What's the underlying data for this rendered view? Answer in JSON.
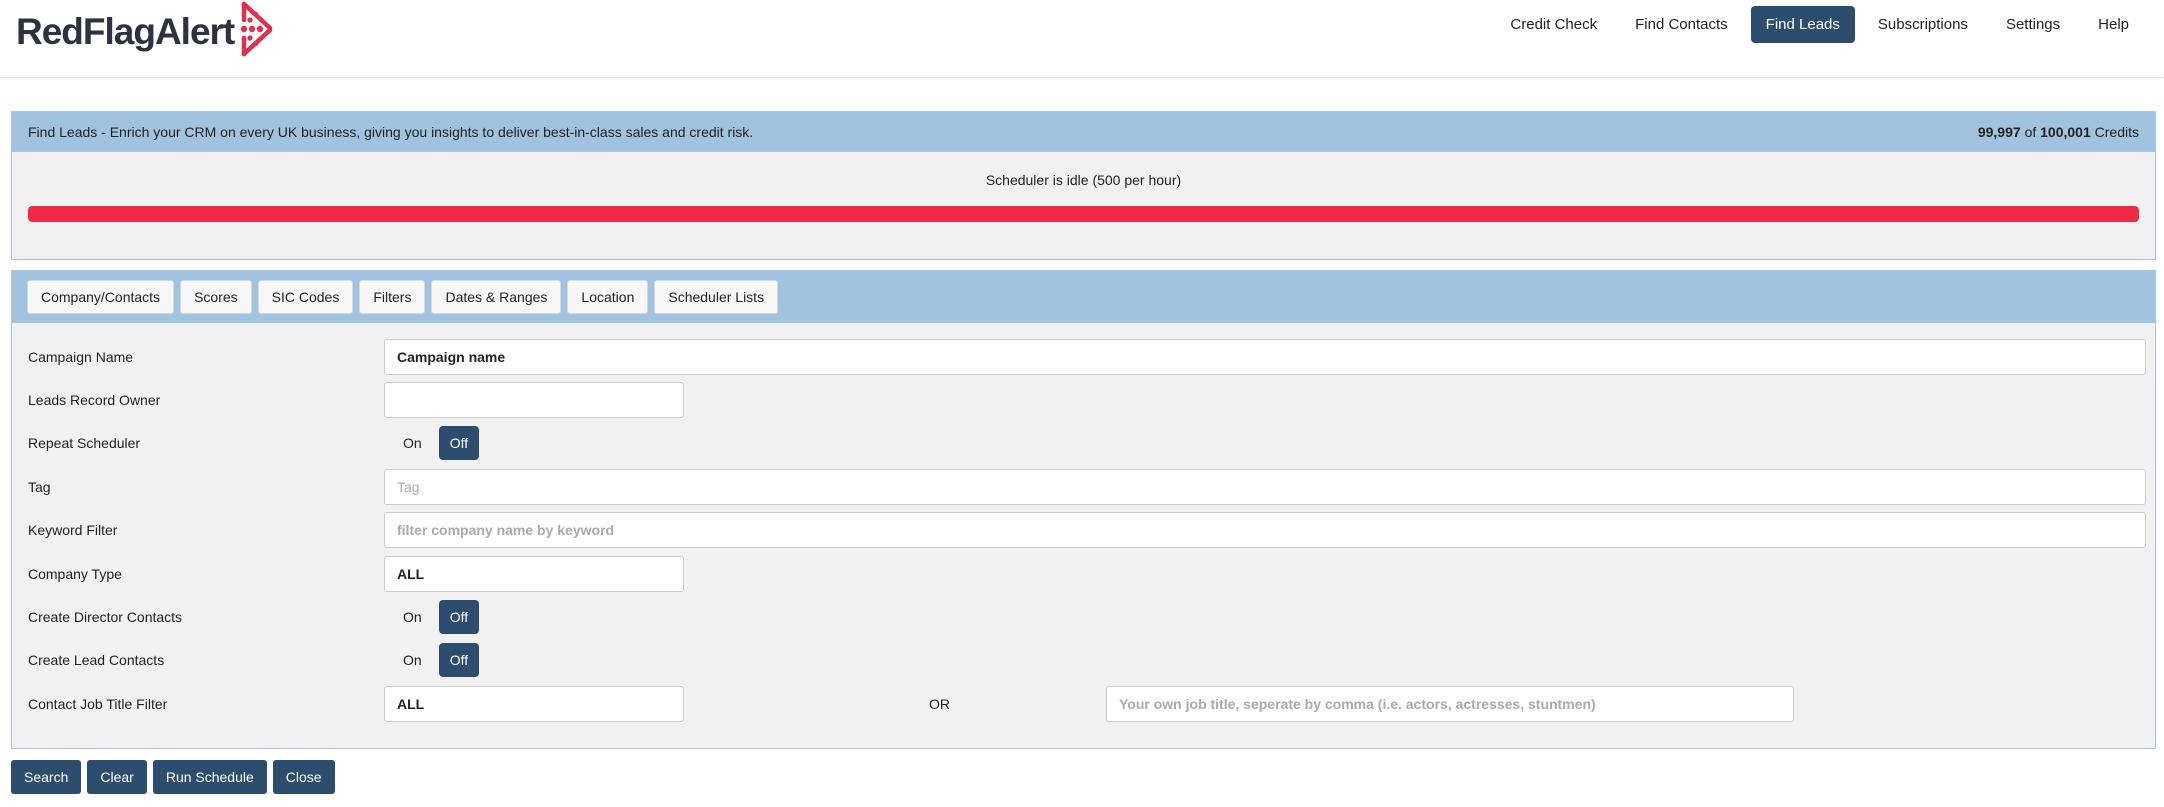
{
  "brand": {
    "name": "RedFlagAlert",
    "color": "#e0304f",
    "text_color": "#2e3240"
  },
  "nav": {
    "items": [
      {
        "label": "Credit Check",
        "active": false
      },
      {
        "label": "Find Contacts",
        "active": false
      },
      {
        "label": "Find Leads",
        "active": true
      },
      {
        "label": "Subscriptions",
        "active": false
      },
      {
        "label": "Settings",
        "active": false
      },
      {
        "label": "Help",
        "active": false
      }
    ]
  },
  "info_panel": {
    "description": "Find Leads - Enrich your CRM on every UK business, giving you insights to deliver best-in-class sales and credit risk.",
    "credits_used": "99,997",
    "credits_of": "of",
    "credits_total": "100,001",
    "credits_label": "Credits",
    "scheduler_status": "Scheduler is idle (500 per hour)",
    "progress_fraction": 1.0,
    "progress_color": "#ef2a45"
  },
  "tabs": [
    {
      "label": "Company/Contacts"
    },
    {
      "label": "Scores"
    },
    {
      "label": "SIC Codes"
    },
    {
      "label": "Filters"
    },
    {
      "label": "Dates & Ranges"
    },
    {
      "label": "Location"
    },
    {
      "label": "Scheduler Lists"
    }
  ],
  "form": {
    "campaign_name": {
      "label": "Campaign Name",
      "value": "Campaign name"
    },
    "leads_record_owner": {
      "label": "Leads Record Owner",
      "value": ""
    },
    "repeat_scheduler": {
      "label": "Repeat Scheduler",
      "on": "On",
      "off": "Off",
      "selected": "Off"
    },
    "tag": {
      "label": "Tag",
      "placeholder": "Tag"
    },
    "keyword_filter": {
      "label": "Keyword Filter",
      "placeholder": "filter company name by keyword"
    },
    "company_type": {
      "label": "Company Type",
      "value": "ALL"
    },
    "create_director_contacts": {
      "label": "Create Director Contacts",
      "on": "On",
      "off": "Off",
      "selected": "Off"
    },
    "create_lead_contacts": {
      "label": "Create Lead Contacts",
      "on": "On",
      "off": "Off",
      "selected": "Off"
    },
    "contact_job_title_filter": {
      "label": "Contact Job Title Filter",
      "value": "ALL",
      "or_text": "OR",
      "placeholder": "Your own job title, seperate by comma (i.e. actors, actresses, stuntmen)"
    }
  },
  "actions": {
    "search": "Search",
    "clear": "Clear",
    "run_schedule": "Run Schedule",
    "close": "Close"
  },
  "colors": {
    "accent": "#2c4d6e",
    "panel_head": "#a1c3e0",
    "panel_body": "#f1f1f1"
  }
}
